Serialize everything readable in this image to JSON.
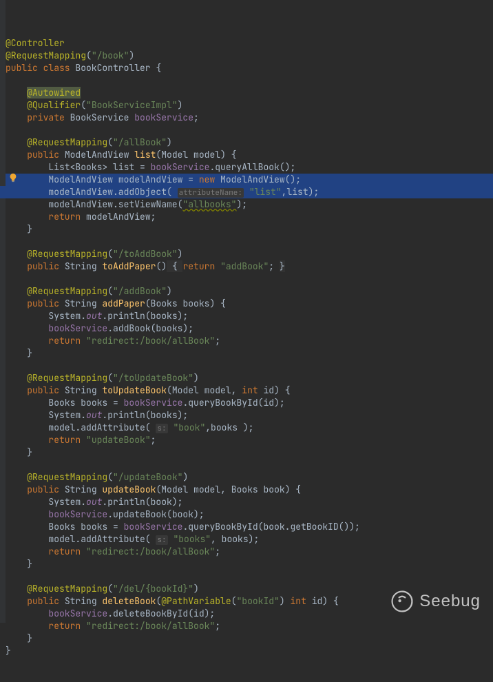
{
  "watermark": {
    "text": "Seebug"
  },
  "icons": {
    "bulb": "lightbulb-icon"
  },
  "code_lines": [
    [
      [
        "ann",
        "@Controller"
      ]
    ],
    [
      [
        "ann",
        "@RequestMapping"
      ],
      [
        "id",
        "("
      ],
      [
        "str",
        "\"/book\""
      ],
      [
        "id",
        ")"
      ]
    ],
    [
      [
        "kw",
        "public class "
      ],
      [
        "cls",
        "BookController"
      ],
      [
        "id",
        " {"
      ]
    ],
    [],
    [
      [
        "ws",
        "    "
      ],
      [
        "ann-hi",
        "@Autowired"
      ]
    ],
    [
      [
        "ws",
        "    "
      ],
      [
        "ann",
        "@Qualifier"
      ],
      [
        "id",
        "("
      ],
      [
        "str",
        "\"BookServiceImpl\""
      ],
      [
        "id",
        ")"
      ]
    ],
    [
      [
        "ws",
        "    "
      ],
      [
        "kw",
        "private "
      ],
      [
        "cls",
        "BookService "
      ],
      [
        "field",
        "bookService"
      ],
      [
        "id",
        ";"
      ]
    ],
    [],
    [
      [
        "ws",
        "    "
      ],
      [
        "ann",
        "@RequestMapping"
      ],
      [
        "id",
        "("
      ],
      [
        "str",
        "\"/allBook\""
      ],
      [
        "id",
        ")"
      ]
    ],
    [
      [
        "ws",
        "    "
      ],
      [
        "kw",
        "public "
      ],
      [
        "cls",
        "ModelAndView "
      ],
      [
        "fn",
        "list"
      ],
      [
        "id",
        "("
      ],
      [
        "cls",
        "Model "
      ],
      [
        "param",
        "model"
      ],
      [
        "id",
        ") {"
      ]
    ],
    [
      [
        "ws",
        "        "
      ],
      [
        "cls",
        "List<Books> "
      ],
      [
        "id",
        "list = "
      ],
      [
        "field",
        "bookService"
      ],
      [
        "id",
        ".queryAllBook();"
      ]
    ],
    [
      [
        "ws",
        "        "
      ],
      [
        "cls",
        "ModelAndView "
      ],
      [
        "id",
        "modelAndView = "
      ],
      [
        "kw",
        "new "
      ],
      [
        "cls",
        "ModelAndView"
      ],
      [
        "id",
        "();"
      ]
    ],
    [
      [
        "ws",
        "        "
      ],
      [
        "id",
        "modelAndView.addObject( "
      ],
      [
        "hint",
        "attributeName:"
      ],
      [
        "id",
        " "
      ],
      [
        "str",
        "\"list\""
      ],
      [
        "id",
        ",list);"
      ]
    ],
    [
      [
        "ws",
        "        "
      ],
      [
        "id",
        "modelAndView.setViewName("
      ],
      [
        "warn",
        "\"allbooks\""
      ],
      [
        "id",
        ");"
      ]
    ],
    [
      [
        "ws",
        "        "
      ],
      [
        "kw",
        "return "
      ],
      [
        "id",
        "modelAndView;"
      ]
    ],
    [
      [
        "ws",
        "    "
      ],
      [
        "id",
        "}"
      ]
    ],
    [],
    [
      [
        "ws",
        "    "
      ],
      [
        "ann",
        "@RequestMapping"
      ],
      [
        "id",
        "("
      ],
      [
        "str",
        "\"/toAddBook\""
      ],
      [
        "id",
        ")"
      ]
    ],
    [
      [
        "ws",
        "    "
      ],
      [
        "kw",
        "public "
      ],
      [
        "cls",
        "String "
      ],
      [
        "fn",
        "toAddPaper"
      ],
      [
        "id",
        "()"
      ],
      [
        "caret-bg",
        " { "
      ],
      [
        "kw",
        "return "
      ],
      [
        "str",
        "\"addBook\""
      ],
      [
        "id",
        "; "
      ],
      [
        "caret-bg",
        "}"
      ]
    ],
    [],
    [
      [
        "ws",
        "    "
      ],
      [
        "ann",
        "@RequestMapping"
      ],
      [
        "id",
        "("
      ],
      [
        "str",
        "\"/addBook\""
      ],
      [
        "id",
        ")"
      ]
    ],
    [
      [
        "ws",
        "    "
      ],
      [
        "kw",
        "public "
      ],
      [
        "cls",
        "String "
      ],
      [
        "fn",
        "addPaper"
      ],
      [
        "id",
        "("
      ],
      [
        "cls",
        "Books "
      ],
      [
        "param",
        "books"
      ],
      [
        "id",
        ") {"
      ]
    ],
    [
      [
        "ws",
        "        "
      ],
      [
        "cls",
        "System."
      ],
      [
        "static",
        "out"
      ],
      [
        "id",
        ".println(books);"
      ]
    ],
    [
      [
        "ws",
        "        "
      ],
      [
        "field",
        "bookService"
      ],
      [
        "id",
        ".addBook(books);"
      ]
    ],
    [
      [
        "ws",
        "        "
      ],
      [
        "kw",
        "return "
      ],
      [
        "str",
        "\"redirect:/book/allBook\""
      ],
      [
        "id",
        ";"
      ]
    ],
    [
      [
        "ws",
        "    "
      ],
      [
        "id",
        "}"
      ]
    ],
    [],
    [
      [
        "ws",
        "    "
      ],
      [
        "ann",
        "@RequestMapping"
      ],
      [
        "id",
        "("
      ],
      [
        "str",
        "\"/toUpdateBook\""
      ],
      [
        "id",
        ")"
      ]
    ],
    [
      [
        "ws",
        "    "
      ],
      [
        "kw",
        "public "
      ],
      [
        "cls",
        "String "
      ],
      [
        "fn",
        "toUpdateBook"
      ],
      [
        "id",
        "("
      ],
      [
        "cls",
        "Model "
      ],
      [
        "param",
        "model"
      ],
      [
        "id",
        ", "
      ],
      [
        "kw",
        "int "
      ],
      [
        "param",
        "id"
      ],
      [
        "id",
        ") {"
      ]
    ],
    [
      [
        "ws",
        "        "
      ],
      [
        "cls",
        "Books "
      ],
      [
        "id",
        "books = "
      ],
      [
        "field",
        "bookService"
      ],
      [
        "id",
        ".queryBookById(id);"
      ]
    ],
    [
      [
        "ws",
        "        "
      ],
      [
        "cls",
        "System."
      ],
      [
        "static",
        "out"
      ],
      [
        "id",
        ".println(books);"
      ]
    ],
    [
      [
        "ws",
        "        "
      ],
      [
        "id",
        "model.addAttribute( "
      ],
      [
        "hint",
        "s:"
      ],
      [
        "id",
        " "
      ],
      [
        "str",
        "\"book\""
      ],
      [
        "id",
        ",books );"
      ]
    ],
    [
      [
        "ws",
        "        "
      ],
      [
        "kw",
        "return "
      ],
      [
        "str",
        "\"updateBook\""
      ],
      [
        "id",
        ";"
      ]
    ],
    [
      [
        "ws",
        "    "
      ],
      [
        "id",
        "}"
      ]
    ],
    [],
    [
      [
        "ws",
        "    "
      ],
      [
        "ann",
        "@RequestMapping"
      ],
      [
        "id",
        "("
      ],
      [
        "str",
        "\"/updateBook\""
      ],
      [
        "id",
        ")"
      ]
    ],
    [
      [
        "ws",
        "    "
      ],
      [
        "kw",
        "public "
      ],
      [
        "cls",
        "String "
      ],
      [
        "fn",
        "updateBook"
      ],
      [
        "id",
        "("
      ],
      [
        "cls",
        "Model "
      ],
      [
        "param",
        "model"
      ],
      [
        "id",
        ", "
      ],
      [
        "cls",
        "Books "
      ],
      [
        "param",
        "book"
      ],
      [
        "id",
        ") {"
      ]
    ],
    [
      [
        "ws",
        "        "
      ],
      [
        "cls",
        "System."
      ],
      [
        "static",
        "out"
      ],
      [
        "id",
        ".println(book);"
      ]
    ],
    [
      [
        "ws",
        "        "
      ],
      [
        "field",
        "bookService"
      ],
      [
        "id",
        ".updateBook(book);"
      ]
    ],
    [
      [
        "ws",
        "        "
      ],
      [
        "cls",
        "Books "
      ],
      [
        "id",
        "books = "
      ],
      [
        "field",
        "bookService"
      ],
      [
        "id",
        ".queryBookById(book.getBookID());"
      ]
    ],
    [
      [
        "ws",
        "        "
      ],
      [
        "id",
        "model.addAttribute( "
      ],
      [
        "hint",
        "s:"
      ],
      [
        "id",
        " "
      ],
      [
        "str",
        "\"books\""
      ],
      [
        "id",
        ", books);"
      ]
    ],
    [
      [
        "ws",
        "        "
      ],
      [
        "kw",
        "return "
      ],
      [
        "str",
        "\"redirect:/book/allBook\""
      ],
      [
        "id",
        ";"
      ]
    ],
    [
      [
        "ws",
        "    "
      ],
      [
        "id",
        "}"
      ]
    ],
    [],
    [
      [
        "ws",
        "    "
      ],
      [
        "ann",
        "@RequestMapping"
      ],
      [
        "id",
        "("
      ],
      [
        "str",
        "\"/del/{bookId}\""
      ],
      [
        "id",
        ")"
      ]
    ],
    [
      [
        "ws",
        "    "
      ],
      [
        "kw",
        "public "
      ],
      [
        "cls",
        "String "
      ],
      [
        "fn",
        "deleteBook"
      ],
      [
        "id",
        "("
      ],
      [
        "ann",
        "@PathVariable"
      ],
      [
        "id",
        "("
      ],
      [
        "str",
        "\"bookId\""
      ],
      [
        "id",
        ") "
      ],
      [
        "kw",
        "int "
      ],
      [
        "param",
        "id"
      ],
      [
        "id",
        ") {"
      ]
    ],
    [
      [
        "ws",
        "        "
      ],
      [
        "field",
        "bookService"
      ],
      [
        "id",
        ".deleteBookById(id);"
      ]
    ],
    [
      [
        "ws",
        "        "
      ],
      [
        "kw",
        "return "
      ],
      [
        "str",
        "\"redirect:/book/allBook\""
      ],
      [
        "id",
        ";"
      ]
    ],
    [
      [
        "ws",
        "    "
      ],
      [
        "id",
        "}"
      ]
    ],
    [
      [
        "id",
        "}"
      ]
    ]
  ],
  "highlighted_line_index": 12
}
